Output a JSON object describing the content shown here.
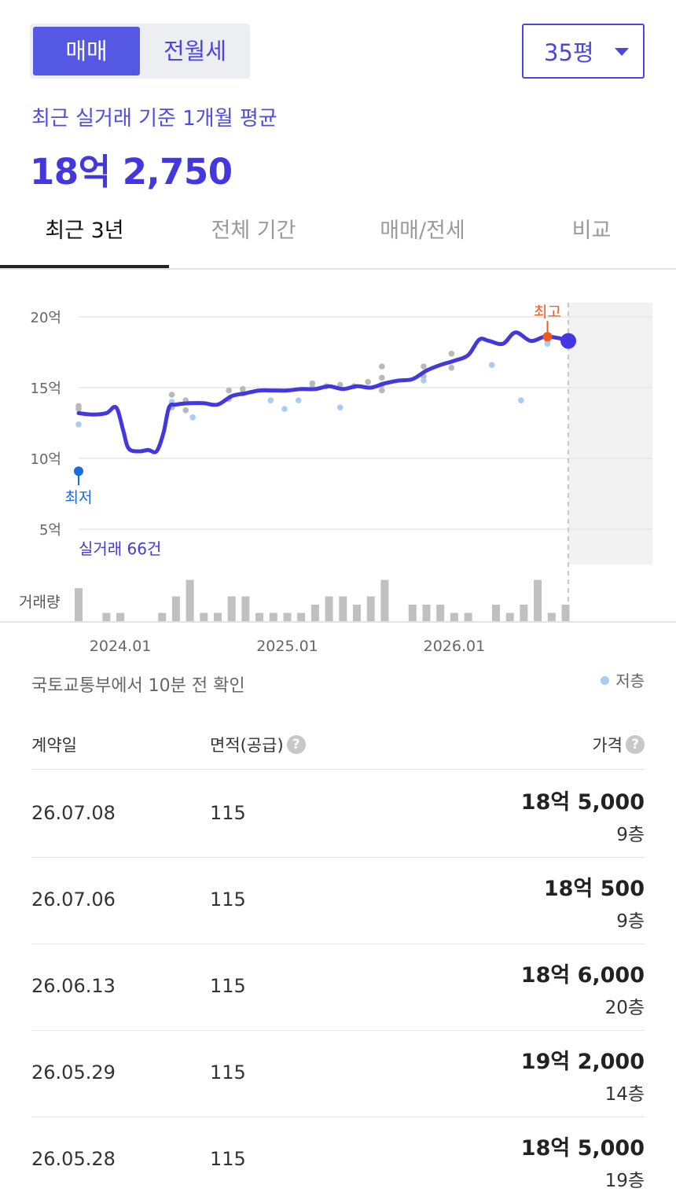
{
  "deal_type_toggle": {
    "selected": "매매",
    "other": "전월세"
  },
  "size_select": {
    "value": "35평"
  },
  "summary": {
    "label": "최근 실거래 기준 1개월 평균",
    "value": "18억 2,750"
  },
  "period_tabs": [
    "최근 3년",
    "전체 기간",
    "매매/전세",
    "비교"
  ],
  "active_tab": 0,
  "colors": {
    "accent": "#4338e0",
    "high": "#f05a1e",
    "low": "#1a6be0",
    "low_floor_dot": "#a9cdf2",
    "other_dot": "#b9b9b9",
    "volume_bar": "#c0c0c0"
  },
  "chart_data": {
    "type": "line",
    "y_unit": "억",
    "ylim": [
      2.5,
      21
    ],
    "y_ticks": [
      5,
      10,
      15,
      20
    ],
    "y_tick_labels": [
      "5억",
      "10억",
      "15억",
      "20억"
    ],
    "x_ticks": [
      "2023-10",
      "2024-01",
      "2024-04",
      "2024-07",
      "2024-10",
      "2025-01",
      "2025-04",
      "2025-07",
      "2025-10",
      "2026-01",
      "2026-04",
      "2026-07"
    ],
    "x_tick_labels": [
      "",
      "2024.01",
      "",
      "",
      "",
      "2025.01",
      "",
      "",
      "",
      "2026.01",
      "",
      ""
    ],
    "annotations": {
      "high_label": "최고",
      "low_label": "최저",
      "count_label": "실거래 66건",
      "volume_label": "거래량"
    },
    "high": {
      "x": 33.7,
      "y": 18.6
    },
    "low": {
      "x": 0,
      "y": 9.1
    },
    "series": [
      {
        "values": [
          [
            0,
            13.2
          ],
          [
            1,
            13.1
          ],
          [
            2,
            13.2
          ],
          [
            2.7,
            13.6
          ],
          [
            3.2,
            12
          ],
          [
            3.6,
            10.7
          ],
          [
            4.4,
            10.5
          ],
          [
            5,
            10.6
          ],
          [
            5.6,
            10.5
          ],
          [
            6.1,
            11.8
          ],
          [
            6.5,
            13.6
          ],
          [
            7,
            13.8
          ],
          [
            8,
            13.9
          ],
          [
            9,
            13.9
          ],
          [
            10,
            13.8
          ],
          [
            11,
            14.4
          ],
          [
            12,
            14.6
          ],
          [
            13,
            14.8
          ],
          [
            14,
            14.8
          ],
          [
            15,
            14.8
          ],
          [
            16,
            14.9
          ],
          [
            17,
            14.9
          ],
          [
            18,
            15.1
          ],
          [
            19,
            14.9
          ],
          [
            20,
            15.1
          ],
          [
            21,
            15
          ],
          [
            22,
            15.3
          ],
          [
            23,
            15.5
          ],
          [
            24,
            15.6
          ],
          [
            25,
            16.2
          ],
          [
            26,
            16.6
          ],
          [
            27,
            16.9
          ],
          [
            28,
            17.3
          ],
          [
            28.8,
            18.4
          ],
          [
            29.5,
            18.3
          ],
          [
            30.5,
            18.1
          ],
          [
            31.4,
            18.9
          ],
          [
            32.5,
            18.3
          ],
          [
            33.5,
            18.6
          ],
          [
            34.5,
            18.5
          ],
          [
            35.2,
            18.3
          ]
        ]
      }
    ],
    "points_low_floor": [
      [
        0,
        12.4
      ],
      [
        6.7,
        14
      ],
      [
        8.2,
        12.9
      ],
      [
        13.8,
        14.1
      ],
      [
        14.8,
        13.5
      ],
      [
        15.8,
        14.1
      ],
      [
        18.8,
        13.6
      ],
      [
        24.8,
        15.5
      ],
      [
        29.7,
        16.6
      ],
      [
        31.8,
        14.1
      ],
      [
        33.7,
        18.1
      ]
    ],
    "points_other": [
      [
        0,
        13.7
      ],
      [
        0,
        13.5
      ],
      [
        6.7,
        14.5
      ],
      [
        6.7,
        13.6
      ],
      [
        7.7,
        14.1
      ],
      [
        7.7,
        13.4
      ],
      [
        10.8,
        14.2
      ],
      [
        10.8,
        14.8
      ],
      [
        11.8,
        14.6
      ],
      [
        11.8,
        14.9
      ],
      [
        16.8,
        15.3
      ],
      [
        16.8,
        15
      ],
      [
        17.8,
        15.1
      ],
      [
        18.8,
        15.2
      ],
      [
        19.8,
        15.1
      ],
      [
        20.8,
        15.4
      ],
      [
        21.8,
        15.7
      ],
      [
        21.8,
        15.2
      ],
      [
        21.8,
        14.8
      ],
      [
        21.8,
        16.5
      ],
      [
        24.8,
        15.8
      ],
      [
        24.8,
        16.5
      ],
      [
        26.8,
        16.4
      ],
      [
        26.8,
        17.4
      ],
      [
        33.7,
        18.2
      ],
      [
        33.7,
        18.5
      ]
    ],
    "volume": [
      [
        0,
        4
      ],
      [
        2,
        1
      ],
      [
        3,
        1
      ],
      [
        6,
        1
      ],
      [
        7,
        3
      ],
      [
        8,
        5
      ],
      [
        9,
        1
      ],
      [
        10,
        1
      ],
      [
        11,
        3
      ],
      [
        12,
        3
      ],
      [
        13,
        1
      ],
      [
        14,
        1
      ],
      [
        15,
        1
      ],
      [
        16,
        1
      ],
      [
        17,
        2
      ],
      [
        18,
        3
      ],
      [
        19,
        3
      ],
      [
        20,
        2
      ],
      [
        21,
        3
      ],
      [
        22,
        5
      ],
      [
        24,
        2
      ],
      [
        25,
        2
      ],
      [
        26,
        2
      ],
      [
        27,
        1
      ],
      [
        28,
        1
      ],
      [
        30,
        2
      ],
      [
        31,
        1
      ],
      [
        32,
        2
      ],
      [
        33,
        5
      ],
      [
        34,
        1
      ],
      [
        35,
        2
      ]
    ],
    "current": {
      "x": 35.2,
      "y": 18.3
    },
    "forecast_shade_from": 35.2,
    "grid": true
  },
  "status": {
    "updated": "국토교통부에서 10분 전 확인",
    "legend_low_floor": "저층"
  },
  "table": {
    "headers": {
      "date": "계약일",
      "area": "면적(공급)",
      "price": "가격"
    },
    "rows": [
      {
        "date": "26.07.08",
        "area": "115",
        "price": "18억 5,000",
        "floor": "9층"
      },
      {
        "date": "26.07.06",
        "area": "115",
        "price": "18억 500",
        "floor": "9층"
      },
      {
        "date": "26.06.13",
        "area": "115",
        "price": "18억 6,000",
        "floor": "20층"
      },
      {
        "date": "26.05.29",
        "area": "115",
        "price": "19억 2,000",
        "floor": "14층"
      },
      {
        "date": "26.05.28",
        "area": "115",
        "price": "18억 5,000",
        "floor": "19층"
      }
    ]
  }
}
